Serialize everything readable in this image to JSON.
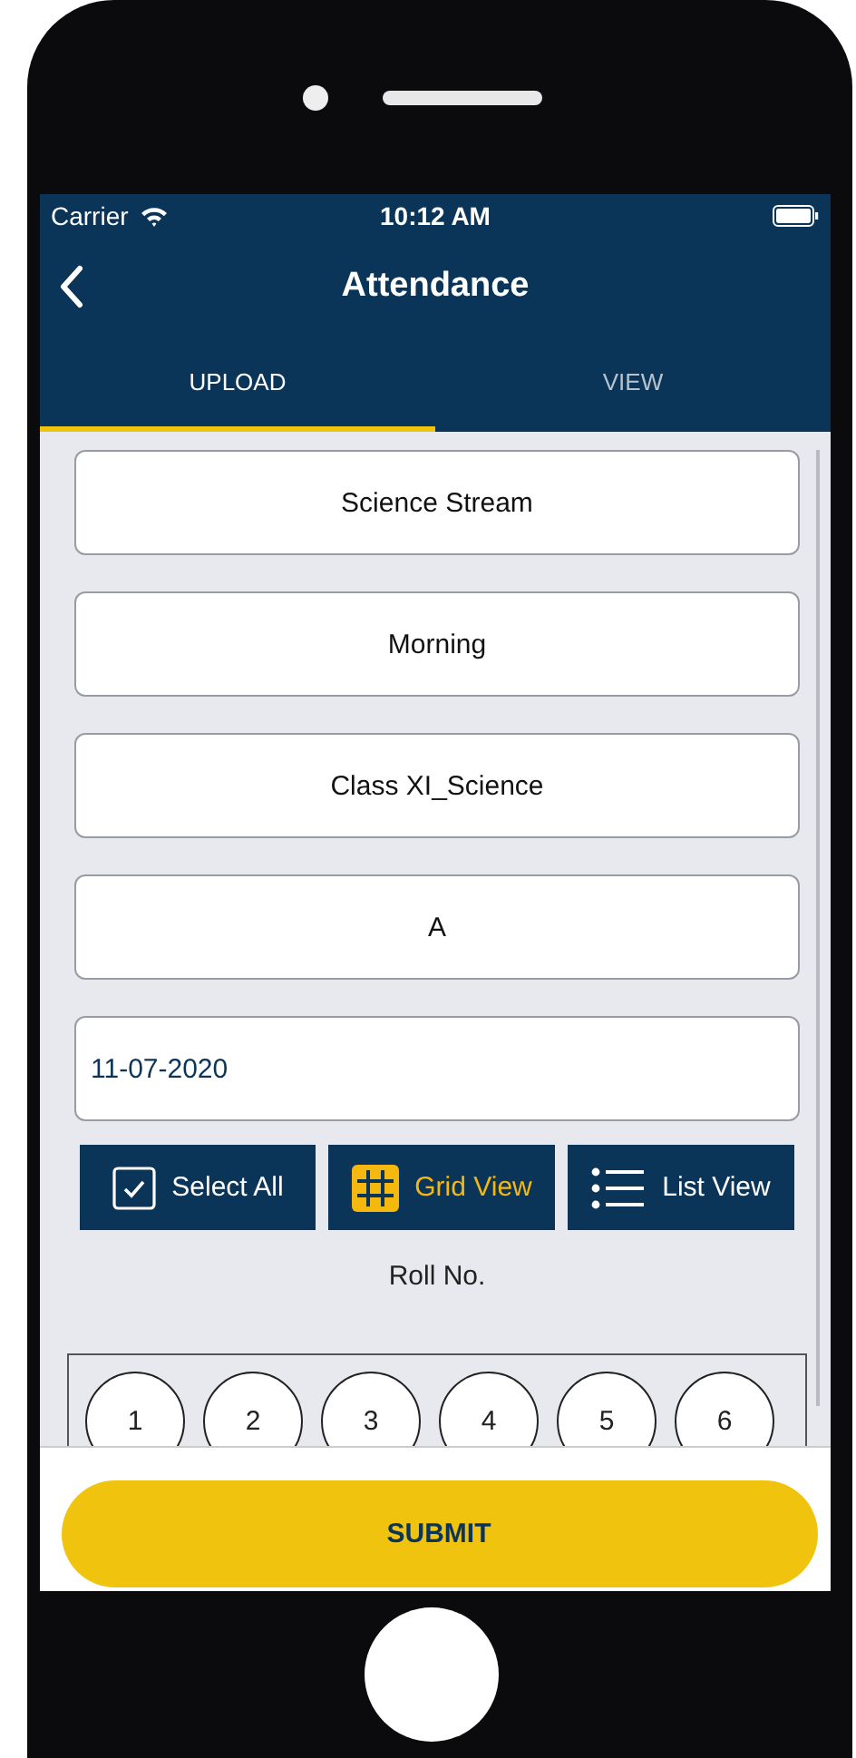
{
  "status_bar": {
    "carrier": "Carrier",
    "time": "10:12 AM"
  },
  "nav": {
    "title": "Attendance"
  },
  "tabs": [
    {
      "label": "UPLOAD",
      "selected": true
    },
    {
      "label": "VIEW",
      "selected": false
    }
  ],
  "fields": [
    {
      "kind": "dropdown",
      "value": "Science Stream"
    },
    {
      "kind": "dropdown",
      "value": "Morning"
    },
    {
      "kind": "dropdown",
      "value": "Class XI_Science"
    },
    {
      "kind": "dropdown",
      "value": "A"
    },
    {
      "kind": "date",
      "value": "11-07-2020"
    }
  ],
  "select_all": {
    "label": "Select All",
    "checked": true
  },
  "view_options": [
    {
      "kind": "grid",
      "label": "Grid View",
      "selected": true
    },
    {
      "kind": "list",
      "label": "List View",
      "selected": false
    }
  ],
  "roll_label": "Roll No.",
  "roll_numbers": [
    "1",
    "2",
    "3",
    "4",
    "5",
    "6"
  ],
  "submit": "SUBMIT"
}
